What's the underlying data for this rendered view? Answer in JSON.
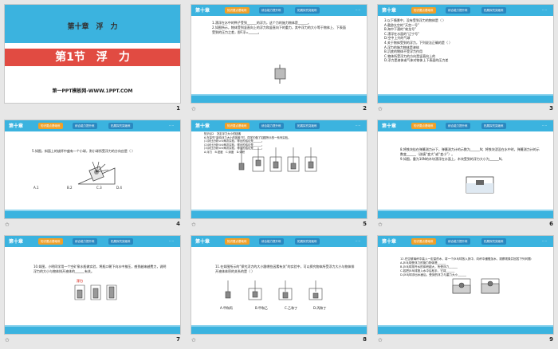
{
  "chapter": "第十章",
  "tabs": [
    "知识要点基础练",
    "综合能力提升练",
    "拓展探究突破练"
  ],
  "page_marker": "-- --",
  "slides": [
    {
      "num": "1",
      "chapter_line": "第十章　浮　力",
      "title": "第1节　浮　力",
      "site": "第一PPT模板网-WWW.1PPT.COM"
    },
    {
      "num": "2",
      "text": "1.漂浮在水中的鸭子受到______的浮力，这个力的施力物体是______。\n2.如图所示，物体受到竖直向上的浮力和竖直向下的重力，其中浮力的大小等于物体上、下表面受到的压力之差，即F浮=______。"
    },
    {
      "num": "3",
      "text": "3.以下情景中，没有受到浮力的物体是（ ）\nA.遨游太空的“天宫一号”\nB.海中下潜的“蛟龙号”\nC.漂浮在水面的“辽宁号”\nD.空中上升的气球\n4.关于物体受到的浮力，下列说法正确的是（ ）\nA.浮力的施力物体是液体\nB.沉底的物体不受浮力作用\nC.物体所受浮力的方向是竖直向上的\nD.浮力是液体或气体对物体上下表面的压力差"
    },
    {
      "num": "4",
      "text": "5.如图，斜面上的烧杯中盛有一个小球，则小球所受浮力的方向应是（ ）",
      "options": [
        "A.1",
        "B.2",
        "C.3",
        "D.4"
      ]
    },
    {
      "num": "5",
      "text": "知识点2　决定浮力大小的因素\n6.在探究“影响浮力大小的因素”时，同学们做了如图所示的一系列实验。\n(1)对比分析②③两次实验，得出的结论是______。\n(2)对比分析③④两次实验，得出的结论是______。\n(3)对比分析④⑤两次实验，得出的结论是______。\nA.浮力　B.密度　C.深度　D.体积"
    },
    {
      "num": "6",
      "text": "8.将铁块挂在弹簧测力计下，弹簧测力计的示数为______N；将铁块浸没在水中时，弹簧测力计的示数变______（选填“变大”或“变小”）。\n9.如图，重为10N的木块漂浮在水面上，木块受到的浮力大小为______N。"
    },
    {
      "num": "7",
      "text": "10.如图，小明同学用一个空矿泉水瓶做实验，将瓶口朝下向水中按压，感到越来越费力，说明浮力的大小与物体排开液体的______有关。",
      "highlight": "浮力"
    },
    {
      "num": "8",
      "text": "11.在如图所示的“探究浮力的大小跟哪些因素有关”的实验中，可以探究物体所受浮力大小与物体排开液体体积的关系的是（ ）",
      "options": [
        "A.甲和丙",
        "B.甲和乙",
        "C.乙和丁",
        "D.丙和丁"
      ]
    },
    {
      "num": "9",
      "text": "12.在空玻璃杯中装入一定量的水，将一个乒乓球放入其中，向杯中缓慢加水，观察现象并回答下列问题：\nA.乒乓球受浮力的施力物体是______\nB.乒乓球排开水的体积越大，所受浮力______\nC.若把乒乓球按入水中后松手，它将______\nD.乒乓球浮出水面后，受到的浮力与重力大小______"
    }
  ]
}
